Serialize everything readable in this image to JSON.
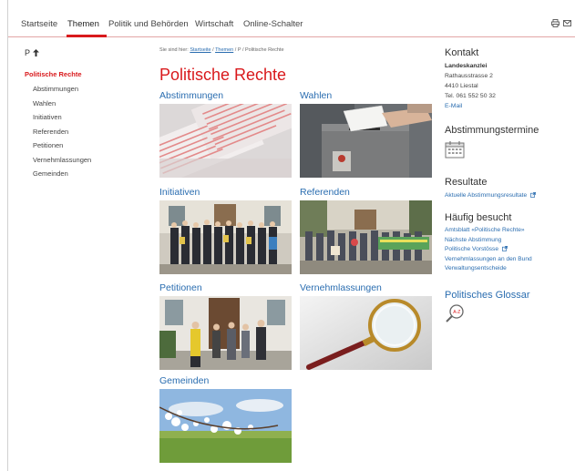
{
  "topnav": {
    "items": [
      "Startseite",
      "Themen",
      "Politik und Behörden",
      "Wirtschaft",
      "Online-Schalter"
    ],
    "active": "Themen",
    "icons": [
      "print-icon",
      "mail-icon"
    ],
    "accent": "#d9191c"
  },
  "sidebar": {
    "letter": "P",
    "current": "Politische Rechte",
    "items": [
      "Abstimmungen",
      "Wahlen",
      "Initiativen",
      "Referenden",
      "Petitionen",
      "Vernehmlassungen",
      "Gemeinden"
    ]
  },
  "main": {
    "breadcrumb": {
      "prefix": "Sie sind hier:",
      "home": "Startseite",
      "sep1": " / ",
      "themen": "Themen",
      "sep2": " / ",
      "letter": "P",
      "sep3": " / ",
      "current": "Politische Rechte"
    },
    "title": "Politische Rechte",
    "tiles": [
      "Abstimmungen",
      "Wahlen",
      "Initiativen",
      "Referenden",
      "Petitionen",
      "Vernehmlassungen",
      "Gemeinden"
    ]
  },
  "right": {
    "kontakt": {
      "heading": "Kontakt",
      "org": "Landeskanzlei",
      "street": "Rathausstrasse 2",
      "city": "4410 Liestal",
      "phone": "Tel. 061 552 50 32",
      "email": "E-Mail"
    },
    "termine": {
      "heading": "Abstimmungstermine"
    },
    "resultate": {
      "heading": "Resultate",
      "link": "Aktuelle Abstimmungsresultate"
    },
    "haeufig": {
      "heading": "Häufig besucht",
      "links": [
        "Amtsblatt «Politische Rechte»",
        "Nächste Abstimmung",
        "Politische Vorstösse",
        "Vernehmlassungen an den Bund",
        "Verwaltungsentscheide"
      ]
    },
    "glossar": {
      "heading": "Politisches Glossar"
    }
  }
}
